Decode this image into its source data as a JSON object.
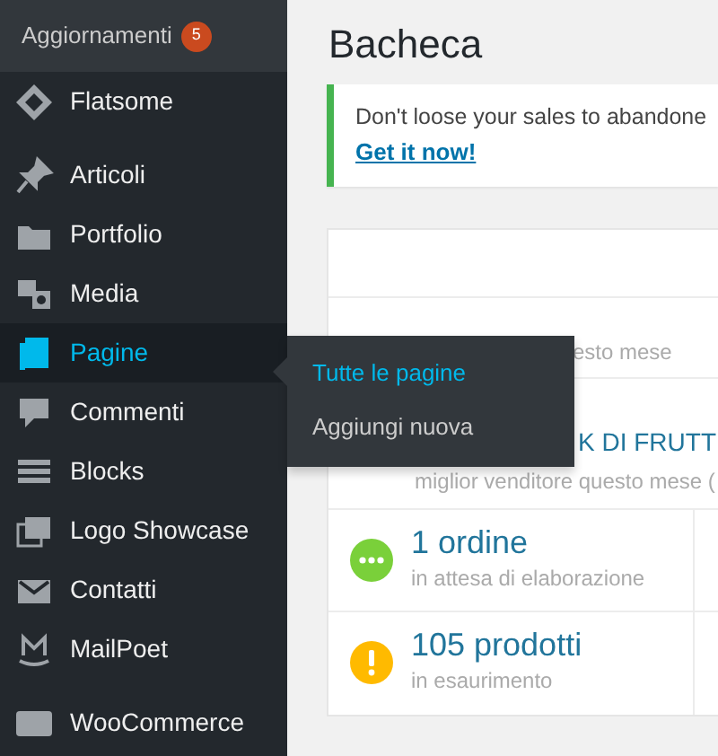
{
  "admin_bar": {
    "label": "Aggiornamenti",
    "count": "5"
  },
  "sidebar": {
    "groups": [
      [
        {
          "label": "Flatsome",
          "selected": false
        }
      ],
      [
        {
          "label": "Articoli",
          "selected": false
        },
        {
          "label": "Portfolio",
          "selected": false
        },
        {
          "label": "Media",
          "selected": false
        },
        {
          "label": "Pagine",
          "selected": true
        },
        {
          "label": "Commenti",
          "selected": false
        },
        {
          "label": "Blocks",
          "selected": false
        },
        {
          "label": "Logo Showcase",
          "selected": false
        },
        {
          "label": "Contatti",
          "selected": false
        },
        {
          "label": "MailPoet",
          "selected": false
        }
      ],
      [
        {
          "label": "WooCommerce",
          "selected": false
        }
      ]
    ]
  },
  "flyout": [
    {
      "label": "Tutte le pagine",
      "selected": true
    },
    {
      "label": "Aggiungi nuova",
      "selected": false
    }
  ],
  "page_title": "Bacheca",
  "notice": {
    "text": "Don't loose your sales to abandone",
    "link": "Get it now!"
  },
  "status": {
    "partial_caption": "esto mese",
    "best_seller": "K DI FRUTT",
    "best_seller_caption": "miglior venditore questo mese (",
    "rows": [
      {
        "kind": "processing",
        "value": "1 ordine",
        "caption": "in attesa di elaborazione"
      },
      {
        "kind": "warning",
        "value": "105 prodotti",
        "caption": "in esaurimento"
      }
    ]
  }
}
